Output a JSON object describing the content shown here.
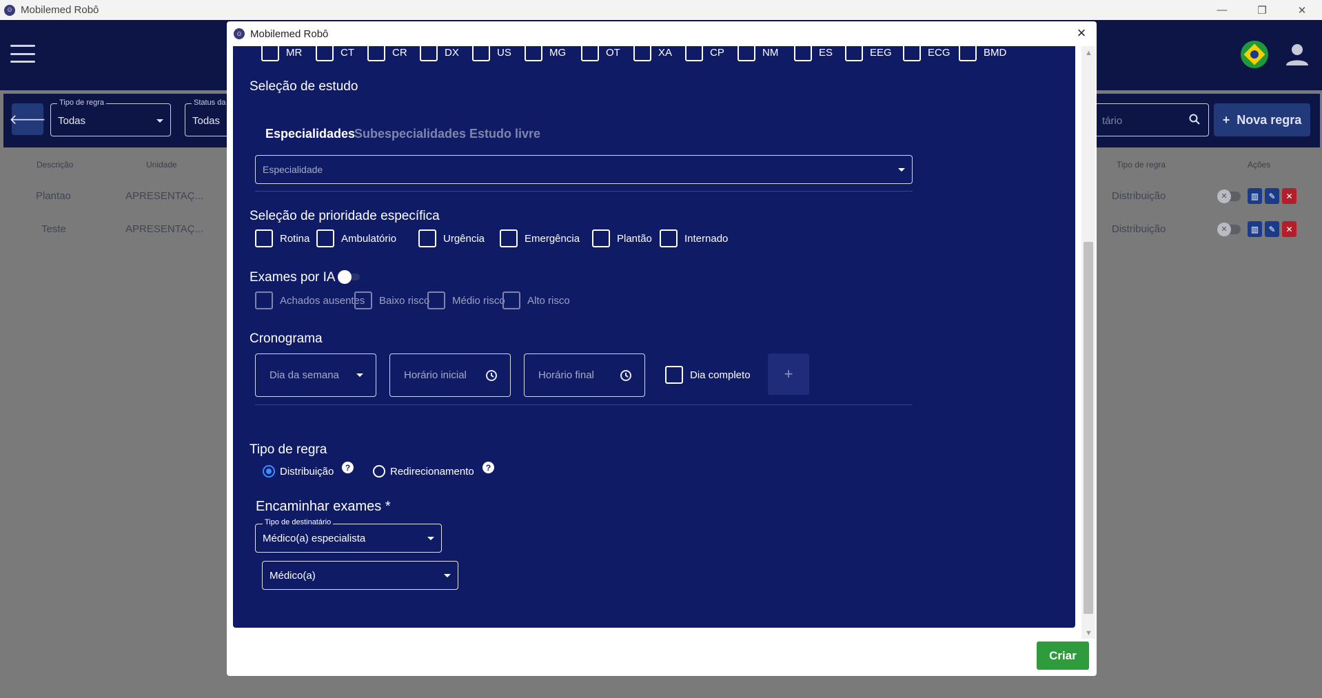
{
  "window": {
    "title": "Mobilemed Robô",
    "minimize": "—",
    "maximize": "❐",
    "close": "✕"
  },
  "background": {
    "filters": {
      "rule_type_label": "Tipo de regra",
      "rule_type_value": "Todas",
      "status_label": "Status da",
      "status_value": "Todas",
      "search_placeholder": "tário",
      "new_rule_label": "Nova regra"
    },
    "table": {
      "headers": {
        "description": "Descrição",
        "unit": "Unidade",
        "rule_type": "Tipo de regra",
        "actions": "Ações"
      },
      "rows": [
        {
          "description": "Plantao",
          "unit": "APRESENTAÇ...",
          "rule_type": "Distribuição"
        },
        {
          "description": "Teste",
          "unit": "APRESENTAÇ...",
          "rule_type": "Distribuição"
        }
      ]
    }
  },
  "modal": {
    "title": "Mobilemed Robô",
    "modalities": [
      "MR",
      "CT",
      "CR",
      "DX",
      "US",
      "MG",
      "OT",
      "XA",
      "CP",
      "NM",
      "ES",
      "EEG",
      "ECG",
      "BMD"
    ],
    "study_selection": {
      "title": "Seleção de estudo",
      "tabs": [
        "Especialidades",
        "Subespecialidades",
        "Estudo livre"
      ],
      "specialty_placeholder": "Especialidade"
    },
    "priority": {
      "title": "Seleção de prioridade específica",
      "options": [
        "Rotina",
        "Ambulatório",
        "Urgência",
        "Emergência",
        "Plantão",
        "Internado"
      ]
    },
    "ai_exams": {
      "title": "Exames por IA",
      "options": [
        "Achados ausentes",
        "Baixo risco",
        "Médio risco",
        "Alto risco"
      ]
    },
    "schedule": {
      "title": "Cronograma",
      "weekday_placeholder": "Dia da semana",
      "start_placeholder": "Horário inicial",
      "end_placeholder": "Horário final",
      "full_day_label": "Dia completo",
      "add_label": "+"
    },
    "rule_type": {
      "title": "Tipo de regra",
      "options": [
        "Distribuição",
        "Redirecionamento"
      ],
      "selected": "Distribuição",
      "help": "?"
    },
    "forward": {
      "title": "Encaminhar exames *",
      "recipient_type_label": "Tipo de destinatário",
      "recipient_type_value": "Médico(a) especialista",
      "doctor_value": "Médico(a)"
    },
    "create_label": "Criar"
  },
  "colors": {
    "panel": "#101b66",
    "header": "#0d1547",
    "create": "#2e9b3c",
    "radio_on": "#3d8bff"
  }
}
